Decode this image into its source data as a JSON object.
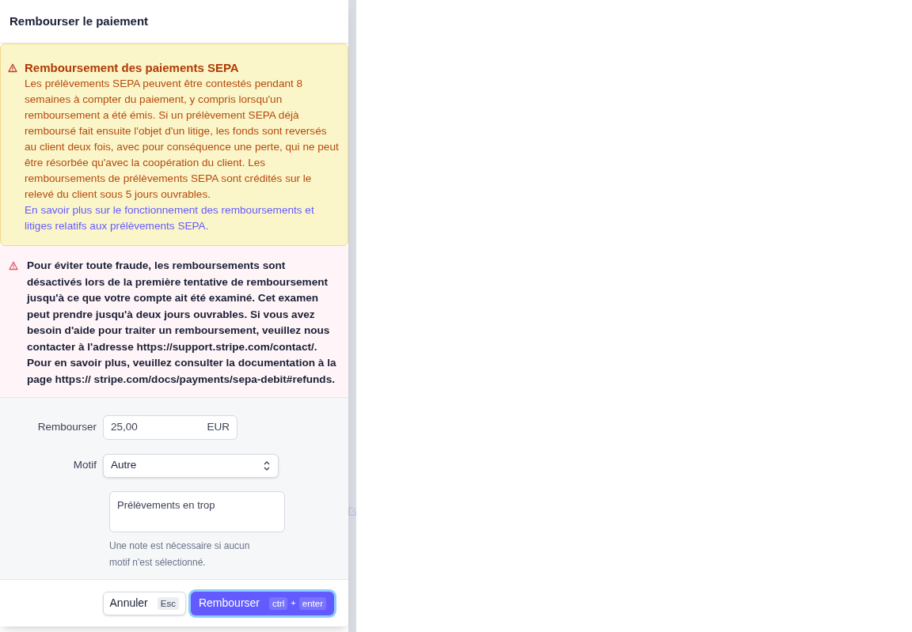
{
  "dialog": {
    "title": "Rembourser le paiement"
  },
  "notices": [
    {
      "kind": "warning",
      "title": "Remboursement des paiements SEPA",
      "body": "Les prélèvements SEPA peuvent être contestés pendant 8 semaines à compter du paiement, y compris lorsqu'un remboursement a été émis. Si un prélèvement SEPA déjà remboursé fait ensuite l'objet d'un litige, les fonds sont reversés au client deux fois, avec pour conséquence une perte, qui ne peut être résorbée qu'avec la coopération du client. Les remboursements de prélèvements SEPA sont crédités sur le relevé du client sous 5 jours ouvrables.",
      "link": "En savoir plus sur le fonctionnement des remboursements et litiges relatifs aux prélèvements SEPA."
    },
    {
      "kind": "danger",
      "body": "Pour éviter toute fraude, les remboursements sont désactivés lors de la première tentative de remboursement jusqu'à ce que votre compte ait été examiné. Cet examen peut prendre jusqu'à deux jours ouvrables. Si vous avez besoin d'aide pour traiter un remboursement, veuillez nous contacter à l'adresse https://support.stripe.com/contact/. Pour en savoir plus, veuillez consulter la documentation à la page https:// stripe.com/docs/payments/sepa-debit#refunds."
    }
  ],
  "form": {
    "amount": {
      "label": "Rembourser",
      "value": "25,00",
      "currency": "EUR"
    },
    "reason": {
      "label": "Motif",
      "value": "Autre"
    },
    "note": {
      "value": "Prélèvements en trop"
    },
    "help": "Une note est nécessaire si aucun motif n'est sélectionné."
  },
  "footer": {
    "buttons": [
      {
        "kind": "secondary",
        "label": "Annuler",
        "keys": [
          "Esc"
        ]
      },
      {
        "kind": "primary",
        "label": "Rembourser",
        "keys": [
          "ctrl",
          "enter"
        ],
        "joiner": "+"
      }
    ]
  }
}
